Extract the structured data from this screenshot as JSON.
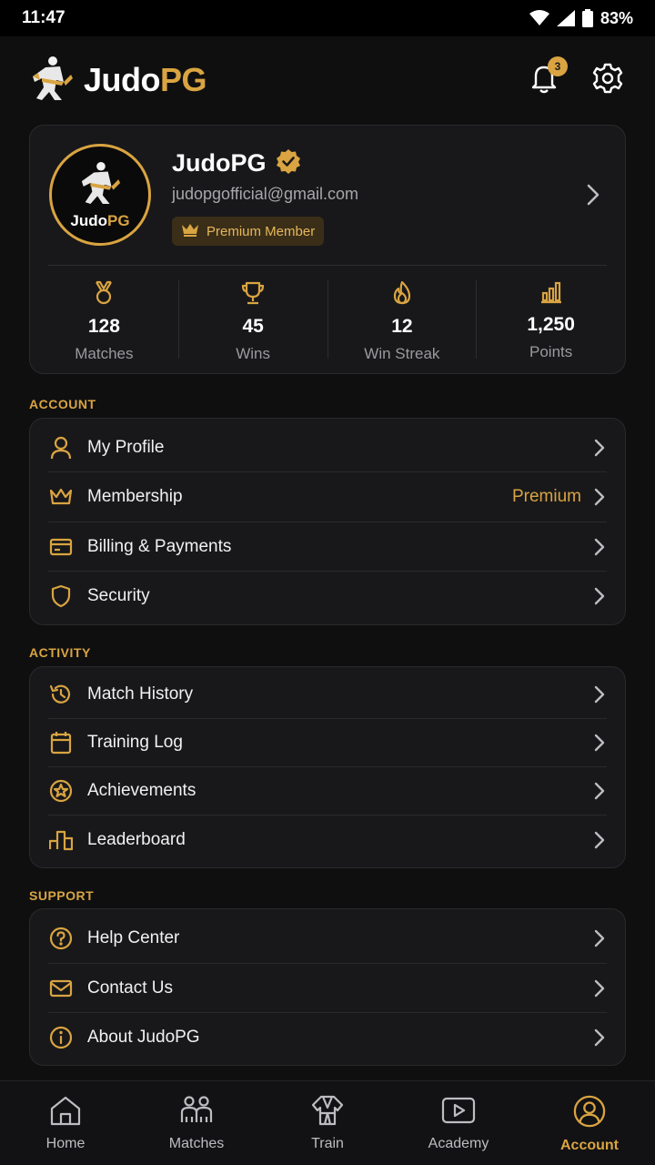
{
  "status_bar": {
    "time": "11:47",
    "battery": "83%"
  },
  "header": {
    "brand_part1": "Judo",
    "brand_part2": "PG",
    "notification_count": "3",
    "icons": [
      "bell-icon",
      "gear-icon"
    ]
  },
  "profile": {
    "avatar_text_part1": "Judo",
    "avatar_text_part2": "PG",
    "name": "JudoPG",
    "email": "judopgofficial@gmail.com",
    "badge": "Premium Member",
    "stats": [
      {
        "icon": "medal-icon",
        "value": "128",
        "label": "Matches"
      },
      {
        "icon": "trophy-icon",
        "value": "45",
        "label": "Wins"
      },
      {
        "icon": "flame-icon",
        "value": "12",
        "label": "Win Streak"
      },
      {
        "icon": "bar-chart-icon",
        "value": "1,250",
        "label": "Points"
      }
    ]
  },
  "sections": {
    "account": {
      "title": "ACCOUNT",
      "items": [
        {
          "icon": "user-icon",
          "label": "My Profile",
          "value": ""
        },
        {
          "icon": "crown-icon",
          "label": "Membership",
          "value": "Premium"
        },
        {
          "icon": "credit-card-icon",
          "label": "Billing & Payments",
          "value": ""
        },
        {
          "icon": "shield-icon",
          "label": "Security",
          "value": ""
        }
      ]
    },
    "activity": {
      "title": "ACTIVITY",
      "items": [
        {
          "icon": "history-icon",
          "label": "Match History"
        },
        {
          "icon": "calendar-icon",
          "label": "Training Log"
        },
        {
          "icon": "achievement-icon",
          "label": "Achievements"
        },
        {
          "icon": "podium-icon",
          "label": "Leaderboard"
        }
      ]
    },
    "support": {
      "title": "SUPPORT",
      "items": [
        {
          "icon": "help-icon",
          "label": "Help Center"
        },
        {
          "icon": "mail-icon",
          "label": "Contact Us"
        },
        {
          "icon": "info-icon",
          "label": "About JudoPG"
        }
      ]
    }
  },
  "bottom_nav": {
    "items": [
      {
        "icon": "home-icon",
        "label": "Home"
      },
      {
        "icon": "people-icon",
        "label": "Matches"
      },
      {
        "icon": "gi-icon",
        "label": "Train"
      },
      {
        "icon": "play-icon",
        "label": "Academy"
      },
      {
        "icon": "account-icon",
        "label": "Account"
      }
    ],
    "active": "Account"
  },
  "colors": {
    "accent": "#d9a441",
    "background": "#0f0f10",
    "card": "#18181a"
  }
}
